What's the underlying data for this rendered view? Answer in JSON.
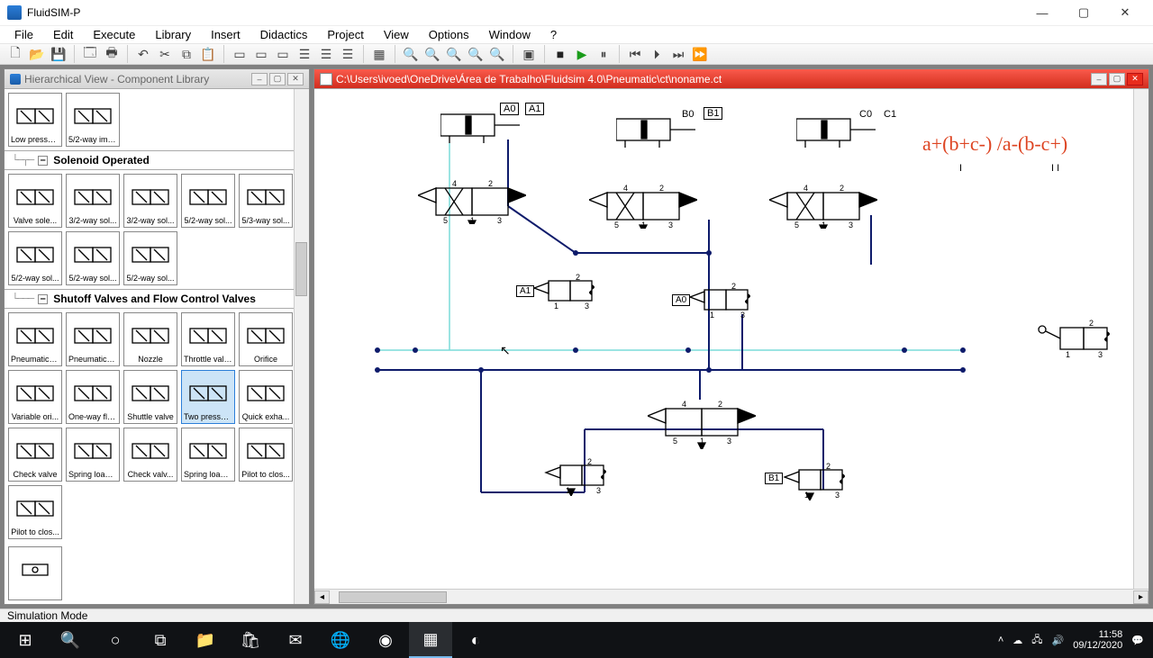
{
  "app": {
    "title": "FluidSIM-P"
  },
  "menu": [
    "File",
    "Edit",
    "Execute",
    "Library",
    "Insert",
    "Didactics",
    "Project",
    "View",
    "Options",
    "Window",
    "?"
  ],
  "panels": {
    "library_title": "Hierarchical View - Component Library",
    "canvas_title": "C:\\Users\\ivoed\\OneDrive\\Área de Trabalho\\Fluidsim 4.0\\Pneumatic\\ct\\noname.ct"
  },
  "library": {
    "top_row": [
      {
        "label": "Low pressur..."
      },
      {
        "label": "5/2-way imp..."
      }
    ],
    "section1": "Solenoid Operated",
    "grid1": [
      {
        "label": "Valve sole..."
      },
      {
        "label": "3/2-way sol..."
      },
      {
        "label": "3/2-way sol..."
      },
      {
        "label": "5/2-way sol..."
      },
      {
        "label": "5/3-way sol..."
      },
      {
        "label": "5/2-way sol..."
      },
      {
        "label": "5/2-way sol..."
      },
      {
        "label": "5/2-way sol..."
      }
    ],
    "section2": "Shutoff Valves and Flow Control Valves",
    "grid2": [
      {
        "label": "Pneumatic t..."
      },
      {
        "label": "Pneumatic t..."
      },
      {
        "label": "Nozzle"
      },
      {
        "label": "Throttle valve"
      },
      {
        "label": "Orifice"
      },
      {
        "label": "Variable ori..."
      },
      {
        "label": "One-way flo..."
      },
      {
        "label": "Shuttle valve"
      },
      {
        "label": "Two pressur...",
        "selected": true
      },
      {
        "label": "Quick exha..."
      },
      {
        "label": "Check valve"
      },
      {
        "label": "Spring loade..."
      },
      {
        "label": "Check valv..."
      },
      {
        "label": "Spring loade..."
      },
      {
        "label": "Pilot to clos..."
      },
      {
        "label": "Pilot to clos..."
      }
    ]
  },
  "canvas": {
    "cyl_labels": [
      [
        "A0",
        "A1"
      ],
      [
        "B0",
        "B1"
      ],
      [
        "C0",
        "C1"
      ]
    ],
    "formula": "a+(b+c-) /a-(b-c+)",
    "small_valve_labels": [
      "A1",
      "A0",
      "B1"
    ]
  },
  "status": "Simulation Mode",
  "taskbar": {
    "time": "11:58",
    "date": "09/12/2020"
  }
}
